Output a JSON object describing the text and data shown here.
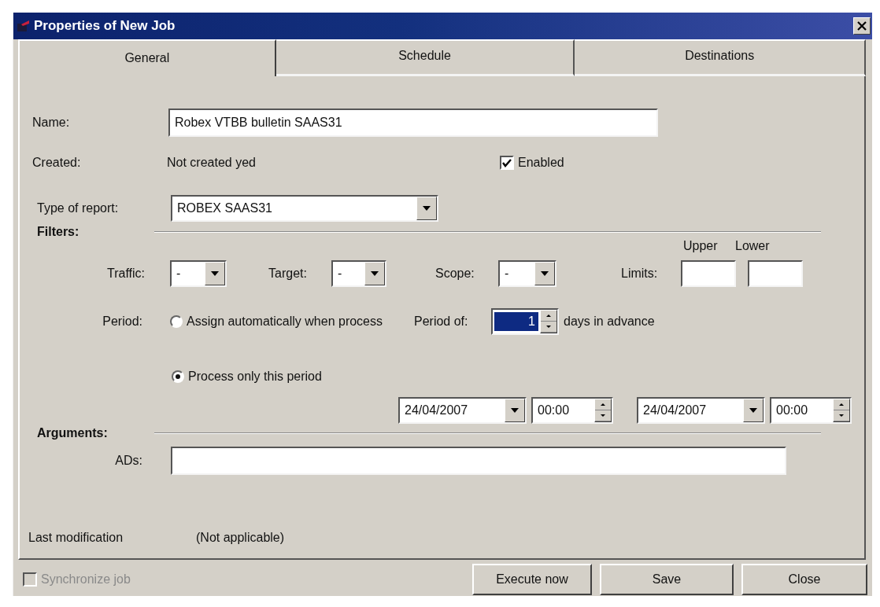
{
  "window": {
    "title": "Properties of New Job"
  },
  "tabs": [
    {
      "label": "General",
      "selected": true
    },
    {
      "label": "Schedule",
      "selected": false
    },
    {
      "label": "Destinations",
      "selected": false
    }
  ],
  "general": {
    "name": {
      "label": "Name:",
      "value": "Robex VTBB bulletin SAAS31"
    },
    "created": {
      "label": "Created:",
      "value": "Not created yed"
    },
    "enabled": {
      "label": "Enabled",
      "checked": true
    },
    "report_type": {
      "label": "Type of report:",
      "value": "ROBEX SAAS31"
    }
  },
  "filters": {
    "heading": "Filters:",
    "dropdowns": [
      {
        "label": "Traffic:",
        "value": "-"
      },
      {
        "label": "Target:",
        "value": "-"
      },
      {
        "label": "Scope:",
        "value": "-"
      }
    ],
    "limits": {
      "label": "Limits:",
      "upper_heading": "Upper",
      "lower_heading": "Lower"
    }
  },
  "period": {
    "label": "Period:",
    "options": [
      {
        "label": "Assign automatically when process",
        "selected": false
      },
      {
        "label": "Process only this period",
        "selected": true
      }
    ],
    "period_of": {
      "label": "Period of:",
      "value": "1",
      "unit": "days in advance"
    },
    "range": [
      {
        "date": "24/04/2007",
        "time": "00:00"
      },
      {
        "date": "24/04/2007",
        "time": "00:00"
      }
    ]
  },
  "arguments": {
    "heading": "Arguments:",
    "ads": {
      "label": "ADs:"
    }
  },
  "last_modification": {
    "label": "Last modification",
    "value": "(Not applicable)"
  },
  "footer": {
    "synchronize": {
      "label": "Synchronize job",
      "checked": false,
      "disabled": true
    },
    "buttons": [
      "Execute now",
      "Save",
      "Close"
    ]
  }
}
